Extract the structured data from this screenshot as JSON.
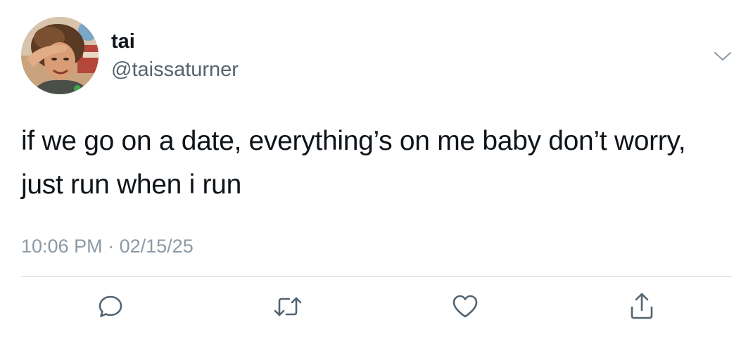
{
  "user": {
    "display_name": "tai",
    "handle": "@taissaturner",
    "avatar_icon": "profile-photo"
  },
  "tweet": {
    "text": "if we go on a date, everything’s on me baby don’t worry, just run when i run",
    "time": "10:06 PM",
    "separator": "·",
    "date": "02/15/25"
  },
  "actions": {
    "reply_icon": "reply-icon",
    "retweet_icon": "retweet-icon",
    "like_icon": "heart-icon",
    "share_icon": "share-icon"
  },
  "colors": {
    "text": "#0f1419",
    "secondary": "#536471",
    "meta": "#8b98a5",
    "icon": "#536471",
    "divider": "#d9dde1"
  }
}
